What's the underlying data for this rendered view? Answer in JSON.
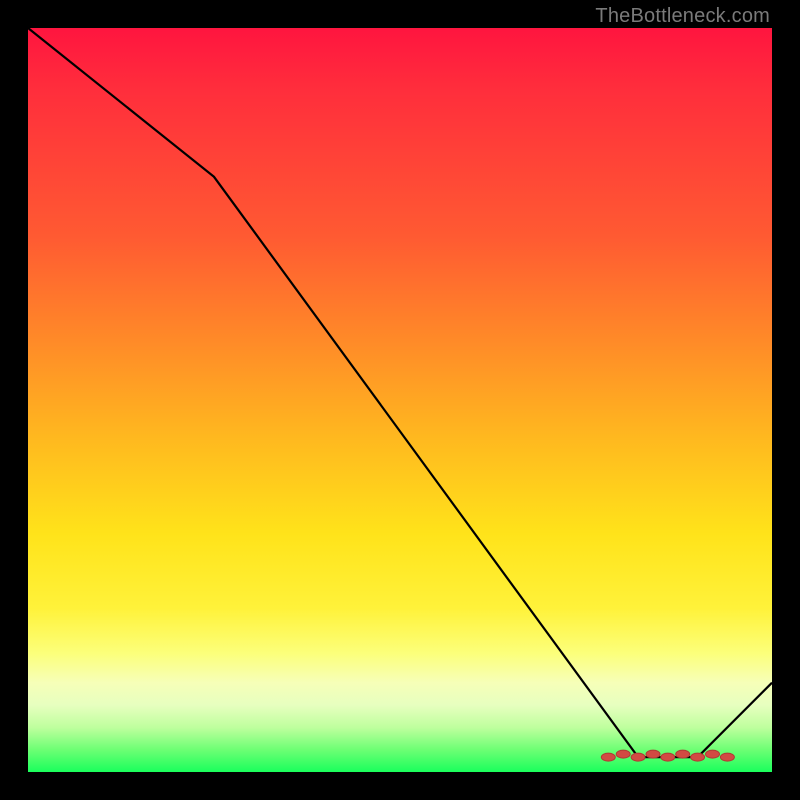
{
  "watermark": "TheBottleneck.com",
  "colors": {
    "background": "#000000",
    "curve": "#000000",
    "marker_fill": "#d24a43",
    "marker_stroke": "#b03a34",
    "gradient_top": "#ff153f",
    "gradient_bottom": "#1aff5c"
  },
  "chart_data": {
    "type": "line",
    "title": "",
    "xlabel": "",
    "ylabel": "",
    "xlim": [
      0,
      100
    ],
    "ylim": [
      0,
      100
    ],
    "grid": false,
    "legend": false,
    "annotations": [],
    "x": [
      0,
      25,
      82,
      90,
      100
    ],
    "y": [
      100,
      80,
      2,
      2,
      12
    ],
    "marker_band": {
      "x_start": 78,
      "x_end": 94,
      "y": 2,
      "count": 9
    }
  }
}
